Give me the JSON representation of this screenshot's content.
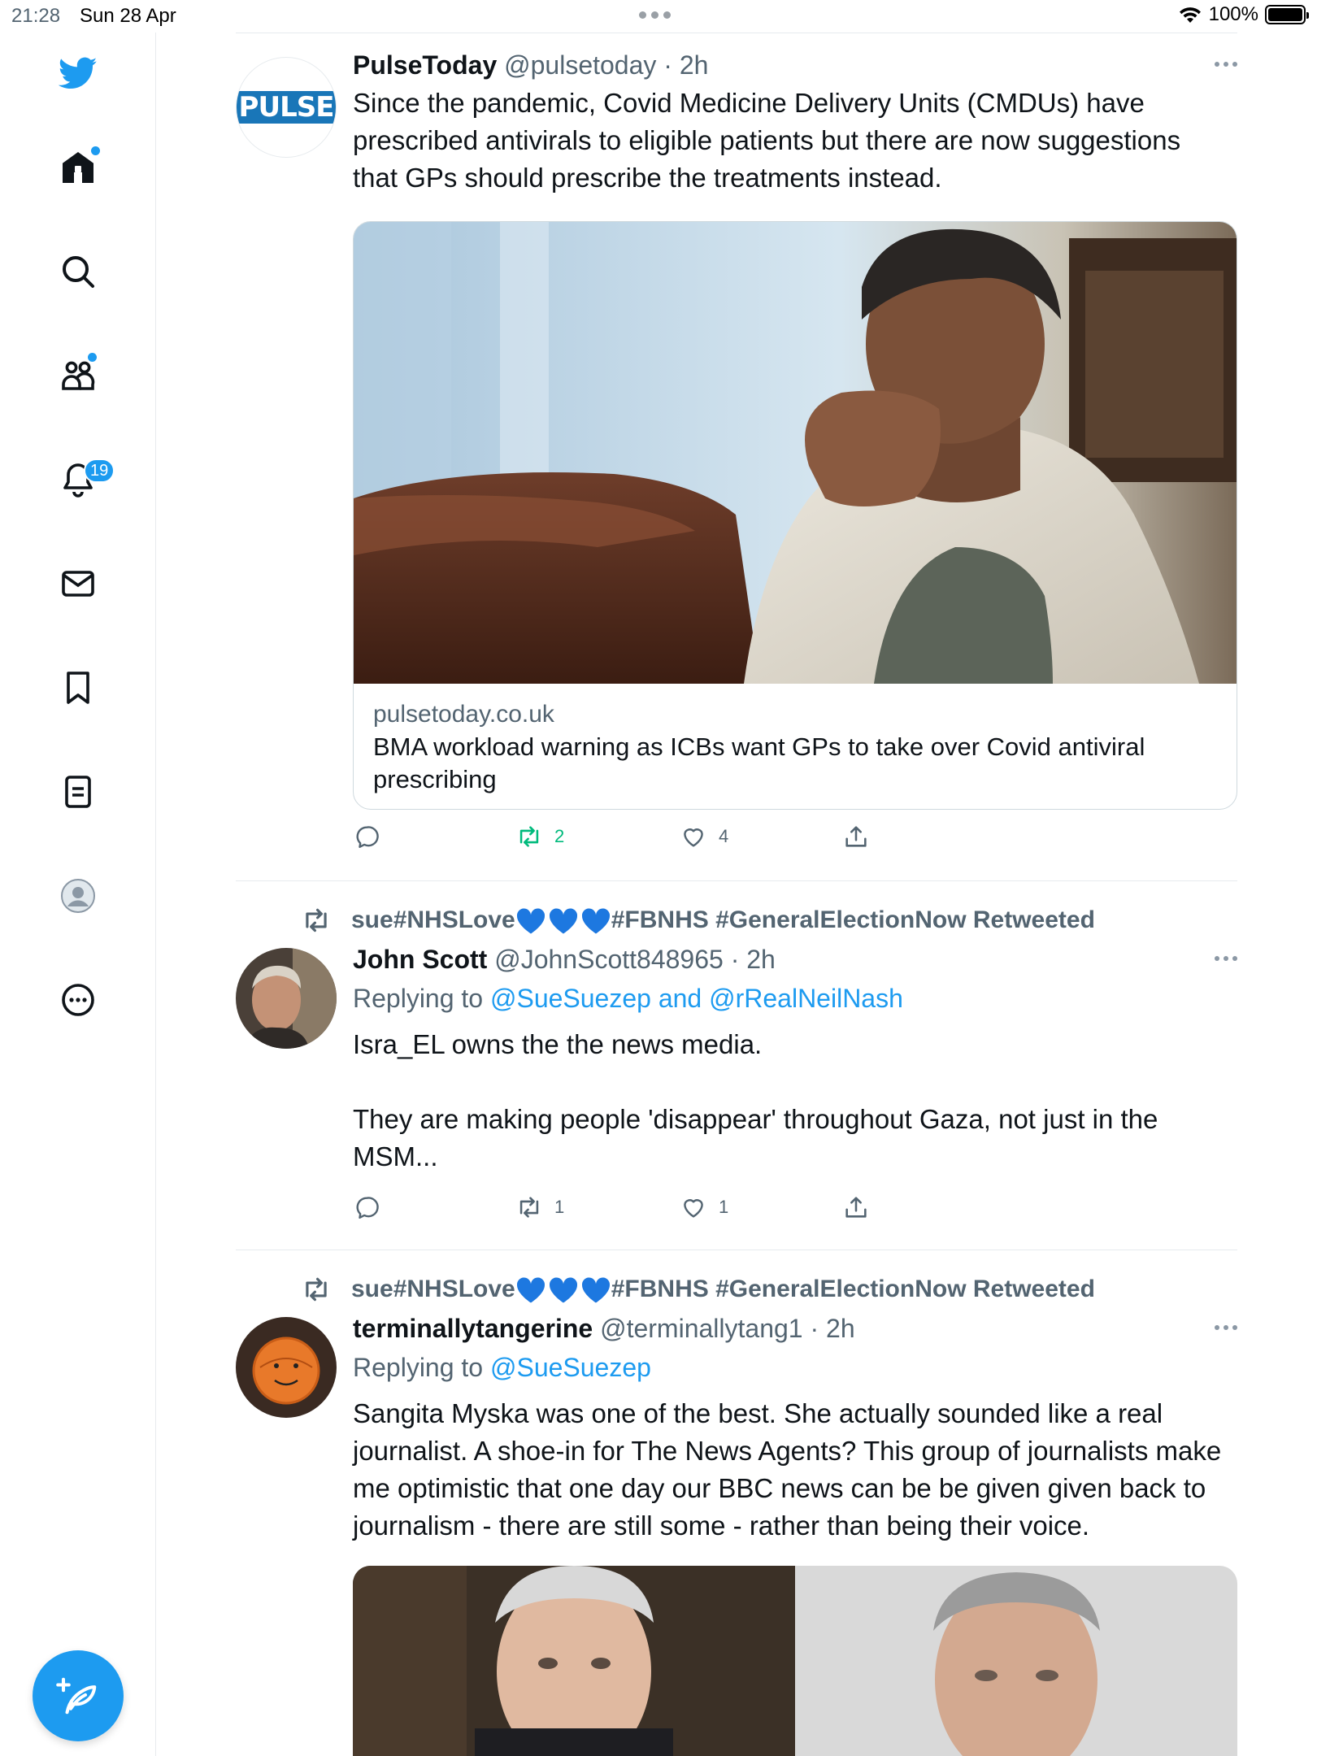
{
  "status_bar": {
    "time": "21:28",
    "date": "Sun 28 Apr",
    "battery": "100%"
  },
  "sidebar": {
    "items": [
      {
        "name": "home",
        "icon": "home-icon"
      },
      {
        "name": "explore",
        "icon": "search-icon"
      },
      {
        "name": "communities",
        "icon": "communities-icon"
      },
      {
        "name": "notifications",
        "icon": "bell-icon",
        "badge": "19"
      },
      {
        "name": "messages",
        "icon": "mail-icon"
      },
      {
        "name": "bookmarks",
        "icon": "bookmark-icon"
      },
      {
        "name": "lists",
        "icon": "lists-icon"
      },
      {
        "name": "profile",
        "icon": "profile-icon"
      },
      {
        "name": "more",
        "icon": "more-circle-icon"
      }
    ],
    "accent": "#1d9bf0"
  },
  "tweets": [
    {
      "name": "PulseToday",
      "handle": "@pulsetoday",
      "time": "2h",
      "avatar_text": "PULSE",
      "text": "Since the pandemic, Covid Medicine Delivery Units (CMDUs) have prescribed antivirals to eligible patients but there are now suggestions that GPs should prescribe the treatments instead.",
      "card": {
        "domain": "pulsetoday.co.uk",
        "title": "BMA workload warning as ICBs want GPs to take over Covid antiviral prescribing"
      },
      "retweets": "2",
      "likes": "4"
    },
    {
      "retweeted_by": "sue#NHSLove",
      "retweeted_by_suffix": "#FBNHS #GeneralElectionNow Retweeted",
      "name": "John Scott",
      "handle": "@JohnScott848965",
      "time": "2h",
      "replying_label": "Replying to",
      "replying_to": "@SueSuezep and @rRealNeilNash",
      "text_1": "Isra_EL owns the the news media.",
      "text_2": "They are making people 'disappear' throughout Gaza, not just in the MSM...",
      "retweets": "1",
      "likes": "1"
    },
    {
      "retweeted_by": "sue#NHSLove",
      "retweeted_by_suffix": "#FBNHS #GeneralElectionNow Retweeted",
      "name": "terminallytangerine",
      "handle": "@terminallytang1",
      "time": "2h",
      "replying_label": "Replying to",
      "replying_to": "@SueSuezep",
      "text": "Sangita Myska was one of the best. She actually sounded like a real journalist. A shoe-in for The News Agents? This group of journalists make me optimistic that one day our BBC news can be be given given back to journalism - there are still some - rather than being their voice."
    }
  ]
}
